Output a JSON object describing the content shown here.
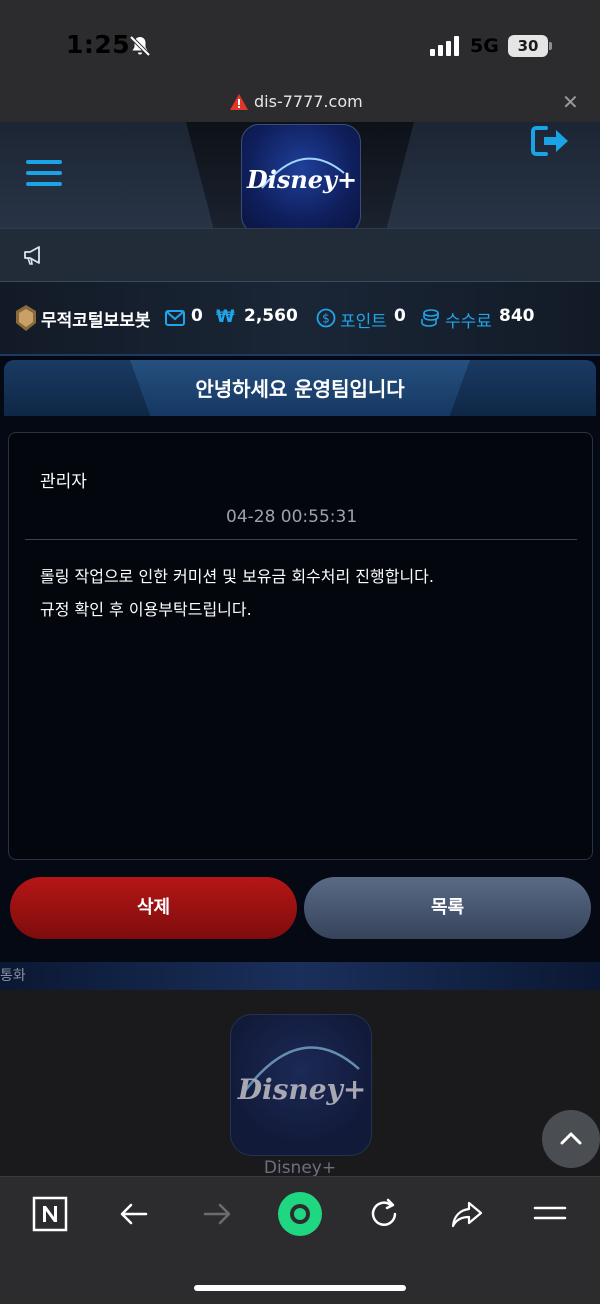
{
  "status_bar": {
    "time": "1:25",
    "network": "5G",
    "battery": "30"
  },
  "browser": {
    "url": "dis-7777.com",
    "close_label": "✕"
  },
  "site": {
    "brand": "Disney+",
    "colors": {
      "accent": "#1ba3e8",
      "delete": "#a81313",
      "list": "#4a5873"
    }
  },
  "user_info": {
    "username": "무적코털보보봇",
    "messages": "0",
    "currency_symbol": "₩",
    "balance": "2,560",
    "points_label": "포인트",
    "points": "0",
    "fee_label": "수수료",
    "fee": "840"
  },
  "post": {
    "title": "안녕하세요 운영팀입니다",
    "author": "관리자",
    "date": "04-28 00:55:31",
    "body_line1": "롤링 작업으로 인한 커미션 및 보유금 회수처리 진행합니다.",
    "body_line2": "규정 확인 후 이용부탁드립니다."
  },
  "buttons": {
    "delete": "삭제",
    "list": "목록"
  },
  "footer": {
    "small_text": "통화",
    "caption": "Disney+"
  }
}
